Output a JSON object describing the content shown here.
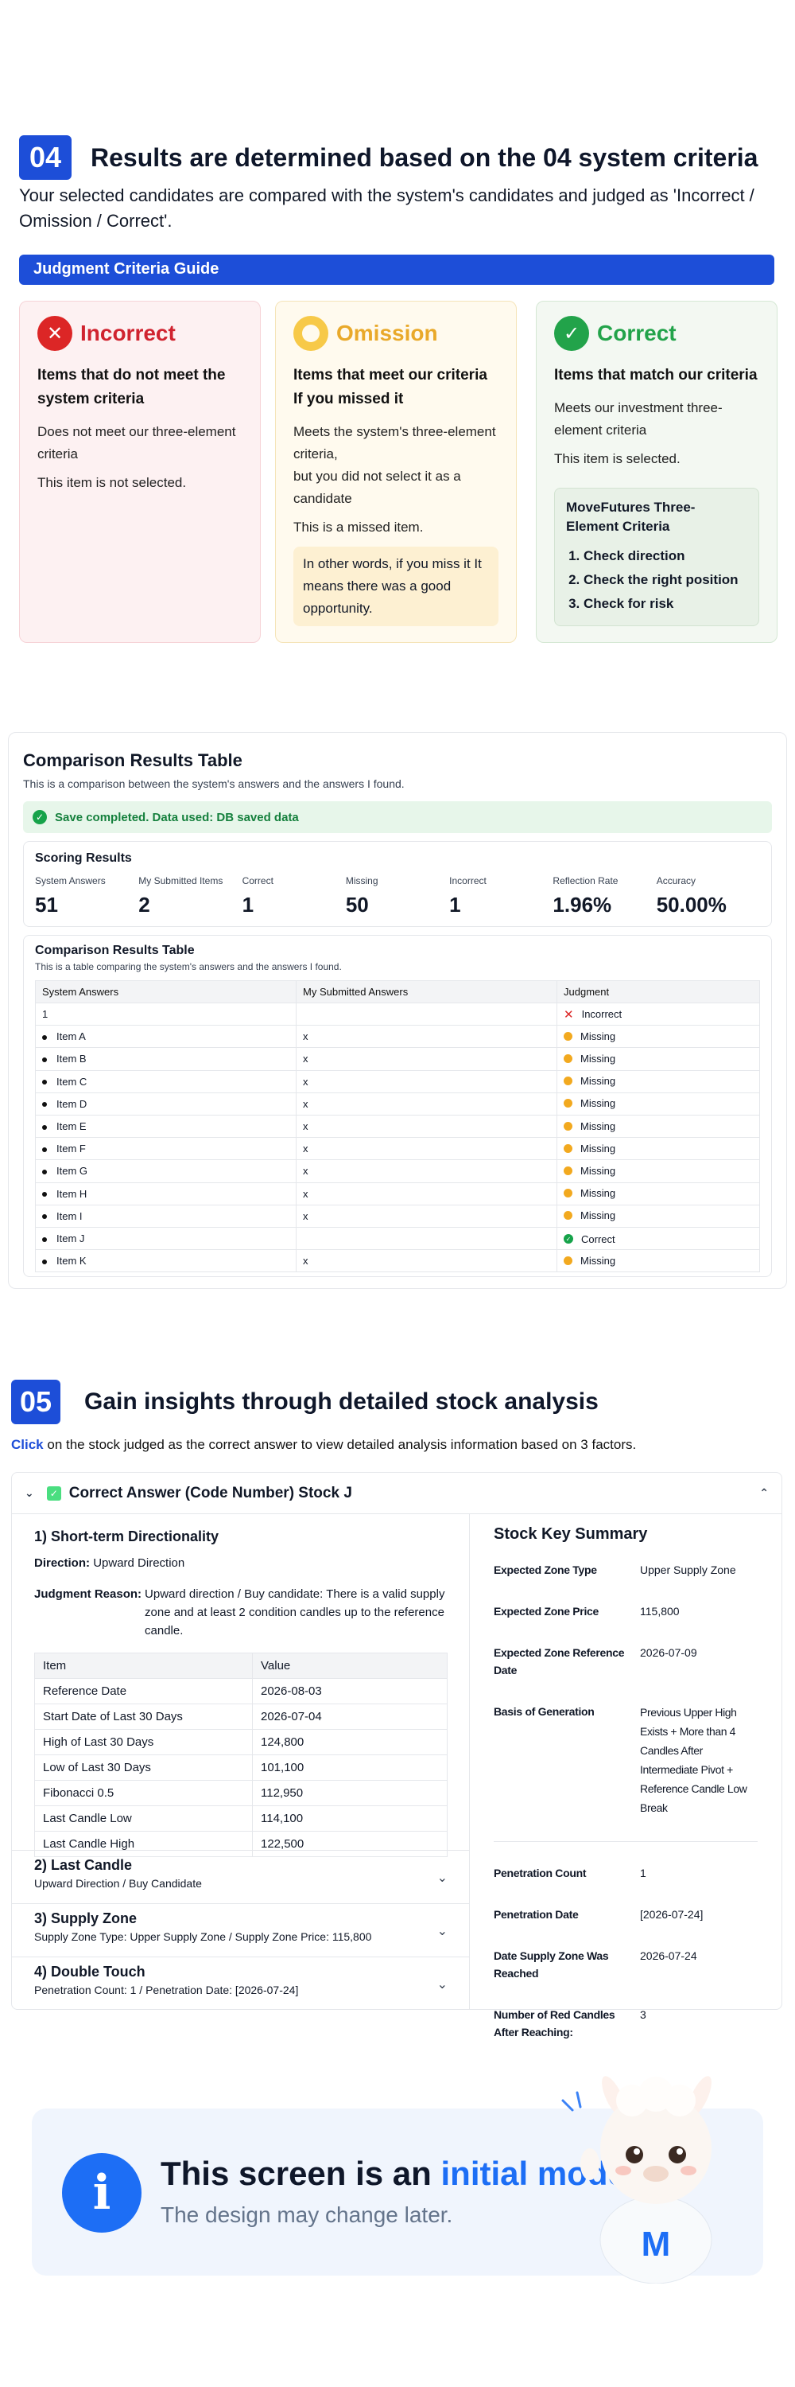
{
  "sec04": {
    "number": "04",
    "title": "Results are determined based on the 04 system criteria",
    "desc": "Your selected candidates are compared with the system's candidates and judged as 'Incorrect / Omission / Correct'.",
    "guide_label": "Judgment Criteria Guide"
  },
  "cards": {
    "incorrect": {
      "icon": "x-circle-icon",
      "label": "Incorrect",
      "heading": "Items that do not meet the system criteria",
      "p1": "Does not meet our three-element criteria",
      "p2": "This item is not selected."
    },
    "omission": {
      "icon": "ring-icon",
      "label": "Omission",
      "heading": "Items that meet our criteria If you missed it",
      "p1": "Meets the system's three-element criteria,",
      "p2": "but you did not select it as a candidate",
      "p3": "This is a missed item.",
      "note": "In other words, if you miss it It means there was a good opportunity."
    },
    "correct": {
      "icon": "check-circle-icon",
      "label": "Correct",
      "heading": "Items that match our criteria",
      "p1": "Meets our investment three-element criteria",
      "p2": "This item is selected.",
      "box_title": "MoveFutures Three-Element Criteria",
      "steps": [
        "Check direction",
        "Check the right position",
        "Check for risk"
      ]
    }
  },
  "comparison": {
    "title": "Comparison Results Table",
    "sub": "This is a comparison between the system's answers and the answers I found.",
    "save_msg": "Save completed. Data used: DB saved data",
    "scoring_title": "Scoring Results",
    "scores": [
      {
        "k": "System Answers",
        "v": "51"
      },
      {
        "k": "My Submitted Items",
        "v": "2"
      },
      {
        "k": "Correct",
        "v": "1"
      },
      {
        "k": "Missing",
        "v": "50"
      },
      {
        "k": "Incorrect",
        "v": "1"
      },
      {
        "k": "Reflection Rate",
        "v": "1.96%"
      },
      {
        "k": "Accuracy",
        "v": "50.00%"
      }
    ],
    "table_title": "Comparison Results Table",
    "table_sub": "This is a table comparing the system's answers and the answers I found.",
    "columns": [
      "System Answers",
      "My Submitted Answers",
      "Judgment"
    ],
    "rows": [
      {
        "sys": "1",
        "mine": "",
        "judge": "Incorrect",
        "type": "incorrect",
        "bullet": false
      },
      {
        "sys": "Item A",
        "mine": "x",
        "judge": "Missing",
        "type": "missing",
        "bullet": true
      },
      {
        "sys": "Item B",
        "mine": "x",
        "judge": "Missing",
        "type": "missing",
        "bullet": true
      },
      {
        "sys": "Item C",
        "mine": "x",
        "judge": "Missing",
        "type": "missing",
        "bullet": true
      },
      {
        "sys": "Item D",
        "mine": "x",
        "judge": "Missing",
        "type": "missing",
        "bullet": true
      },
      {
        "sys": "Item E",
        "mine": "x",
        "judge": "Missing",
        "type": "missing",
        "bullet": true
      },
      {
        "sys": "Item F",
        "mine": "x",
        "judge": "Missing",
        "type": "missing",
        "bullet": true
      },
      {
        "sys": "Item G",
        "mine": "x",
        "judge": "Missing",
        "type": "missing",
        "bullet": true
      },
      {
        "sys": "Item H",
        "mine": "x",
        "judge": "Missing",
        "type": "missing",
        "bullet": true
      },
      {
        "sys": "Item I",
        "mine": "x",
        "judge": "Missing",
        "type": "missing",
        "bullet": true
      },
      {
        "sys": "Item J",
        "mine": "",
        "judge": "Correct",
        "type": "correct",
        "bullet": true
      },
      {
        "sys": "Item K",
        "mine": "x",
        "judge": "Missing",
        "type": "missing",
        "bullet": true
      }
    ]
  },
  "sec05": {
    "number": "05",
    "title": "Gain insights through detailed stock analysis",
    "desc_click": "Click",
    "desc_rest": " on the stock judged as the correct answer to view detailed analysis information based on 3 factors."
  },
  "detail": {
    "header": "Correct Answer (Code Number) Stock J",
    "s1_title": "1) Short-term Directionality",
    "direction_k": "Direction:",
    "direction_v": "Upward Direction",
    "reason_k": "Judgment Reason:",
    "reason_v": "Upward direction / Buy candidate: There is a valid supply zone and at least 2 condition candles up to the reference candle.",
    "table_cols": [
      "Item",
      "Value"
    ],
    "table_rows": [
      [
        "Reference Date",
        "2026-08-03"
      ],
      [
        "Start Date of Last 30 Days",
        "2026-07-04"
      ],
      [
        "High of Last 30 Days",
        "124,800"
      ],
      [
        "Low of Last 30 Days",
        "101,100"
      ],
      [
        "Fibonacci 0.5",
        "112,950"
      ],
      [
        "Last Candle Low",
        "114,100"
      ],
      [
        "Last Candle High",
        "122,500"
      ]
    ],
    "accordions": [
      {
        "title": "2) Last Candle",
        "sub": "Upward Direction / Buy Candidate"
      },
      {
        "title": "3) Supply Zone",
        "sub": "Supply Zone Type: Upper Supply Zone / Supply Zone Price: 115,800"
      },
      {
        "title": "4) Double Touch",
        "sub": "Penetration Count: 1 / Penetration Date: [2026-07-24]"
      }
    ],
    "summary_title": "Stock Key Summary",
    "summary_a": [
      {
        "k": "Expected Zone Type",
        "v": "Upper Supply Zone"
      },
      {
        "k": "Expected Zone Price",
        "v": "115,800"
      },
      {
        "k": "Expected Zone Reference Date",
        "v": "2026-07-09"
      },
      {
        "k": "Basis of Generation",
        "v": "Previous Upper High Exists + More than 4 Candles After Intermediate Pivot + Reference Candle Low Break"
      }
    ],
    "summary_b": [
      {
        "k": "Penetration Count",
        "v": "1"
      },
      {
        "k": "Penetration Date",
        "v": "[2026-07-24]"
      },
      {
        "k": "Date Supply Zone Was Reached",
        "v": "2026-07-24"
      },
      {
        "k": "Number of Red Candles After Reaching:",
        "v": "3"
      }
    ]
  },
  "notice": {
    "line1_a": "This screen is an ",
    "line1_b": "initial model",
    "line2": "The design may change later.",
    "mascot_letter": "M"
  },
  "colors": {
    "primary": "#1d4ed8",
    "incorrect": "#dc2626",
    "omission": "#f2a91f",
    "correct": "#16a34a"
  }
}
